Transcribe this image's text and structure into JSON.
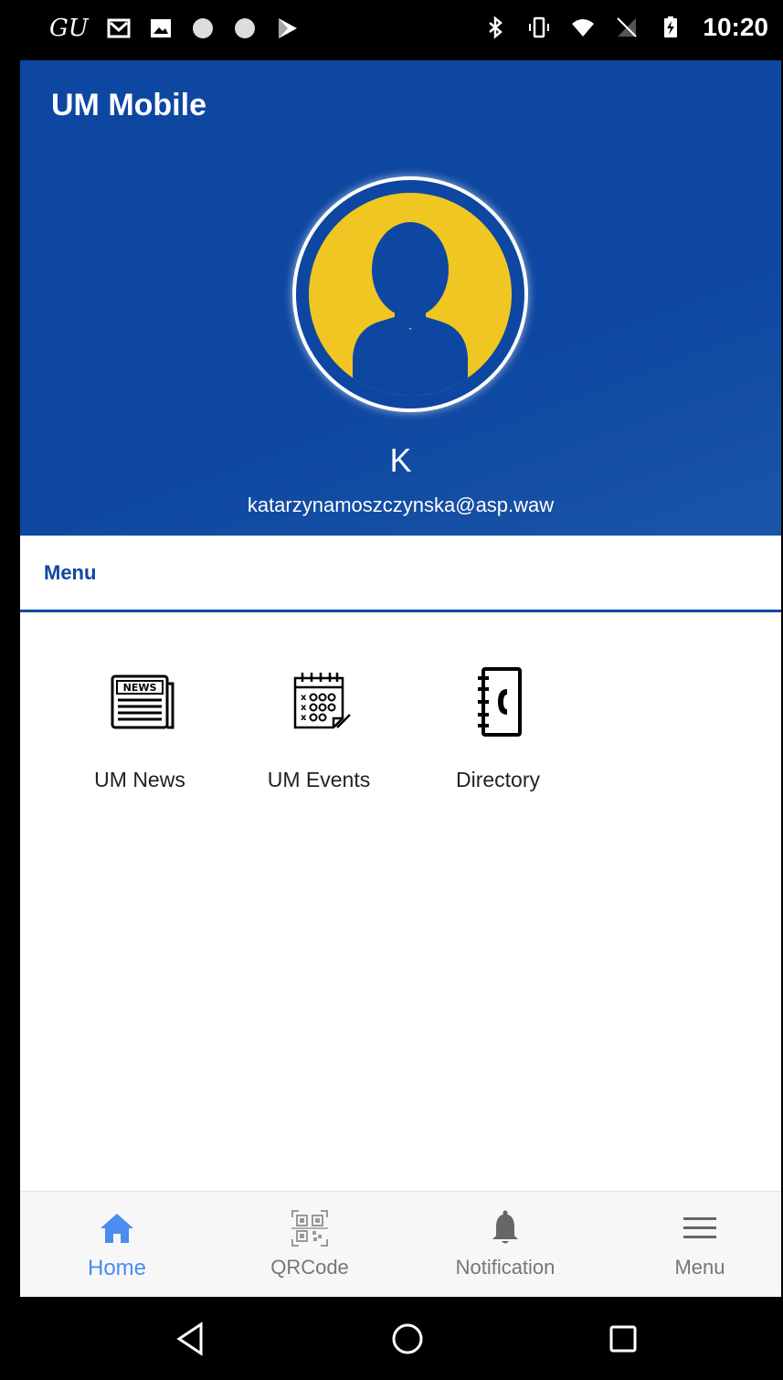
{
  "status_bar": {
    "carrier_glyph": "GU",
    "time": "10:20",
    "icons_left": [
      "gmail-icon",
      "image-icon",
      "circle-icon",
      "circle-icon",
      "play-store-icon"
    ],
    "icons_right": [
      "bluetooth-icon",
      "vibrate-icon",
      "wifi-icon",
      "no-sim-icon",
      "battery-charging-icon"
    ]
  },
  "app_bar": {
    "title": "UM Mobile"
  },
  "profile": {
    "initial": "K",
    "email": "katarzynamoszczynska@asp.waw",
    "colors": {
      "header": "#0D47A1",
      "avatar": "#F0C623"
    }
  },
  "menu_tab": {
    "label": "Menu"
  },
  "menu_items": [
    {
      "label": "UM News",
      "icon": "news-icon",
      "icon_text": "NEWS"
    },
    {
      "label": "UM Events",
      "icon": "calendar-icon"
    },
    {
      "label": "Directory",
      "icon": "phone-book-icon"
    }
  ],
  "bottom_nav": [
    {
      "label": "Home",
      "icon": "home-icon",
      "active": true
    },
    {
      "label": "QRCode",
      "icon": "qr-code-icon",
      "active": false
    },
    {
      "label": "Notification",
      "icon": "bell-icon",
      "active": false
    },
    {
      "label": "Menu",
      "icon": "hamburger-icon",
      "active": false
    }
  ],
  "colors": {
    "accent": "#4A8CF0",
    "primary": "#0D47A1"
  }
}
